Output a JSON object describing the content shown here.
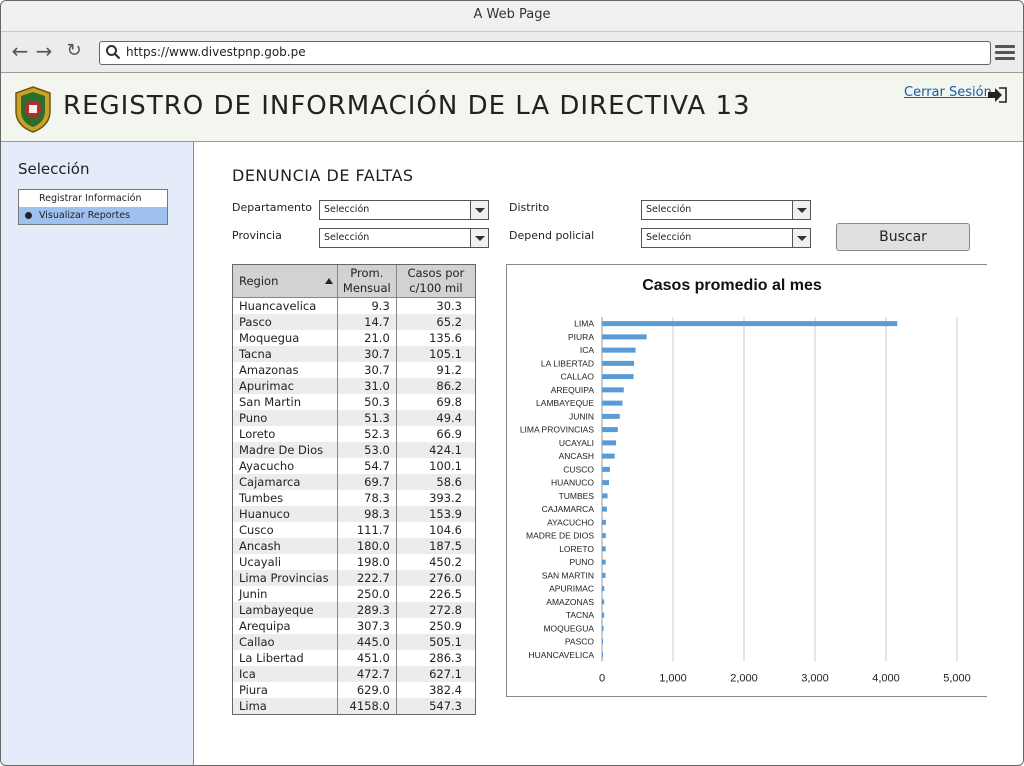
{
  "window": {
    "title": "A Web Page"
  },
  "browser": {
    "url": "https://www.divestpnp.gob.pe"
  },
  "header": {
    "title": "REGISTRO DE INFORMACIÓN DE LA DIRECTIVA 13",
    "logout_label": "Cerrar Sesión"
  },
  "sidebar": {
    "title": "Selección",
    "items": [
      {
        "label": "Registrar Información",
        "active": false
      },
      {
        "label": "Visualizar Reportes",
        "active": true
      }
    ]
  },
  "main": {
    "section_title": "DENUNCIA DE FALTAS",
    "filters": {
      "departamento": {
        "label": "Departamento",
        "value": "Selección"
      },
      "provincia": {
        "label": "Provincia",
        "value": "Selección"
      },
      "distrito": {
        "label": "Distrito",
        "value": "Selección"
      },
      "depend": {
        "label": "Depend policial",
        "value": "Selección"
      }
    },
    "search_label": "Buscar",
    "table": {
      "headers": {
        "region": "Region",
        "prom_1": "Prom.",
        "prom_2": "Mensual",
        "casos_1": "Casos por",
        "casos_2": "c/100 mil"
      },
      "rows": [
        [
          "Huancavelica",
          "9.3",
          "30.3"
        ],
        [
          "Pasco",
          "14.7",
          "65.2"
        ],
        [
          "Moquegua",
          "21.0",
          "135.6"
        ],
        [
          "Tacna",
          "30.7",
          "105.1"
        ],
        [
          "Amazonas",
          "30.7",
          "91.2"
        ],
        [
          "Apurimac",
          "31.0",
          "86.2"
        ],
        [
          "San Martin",
          "50.3",
          "69.8"
        ],
        [
          "Puno",
          "51.3",
          "49.4"
        ],
        [
          "Loreto",
          "52.3",
          "66.9"
        ],
        [
          "Madre De Dios",
          "53.0",
          "424.1"
        ],
        [
          "Ayacucho",
          "54.7",
          "100.1"
        ],
        [
          "Cajamarca",
          "69.7",
          "58.6"
        ],
        [
          "Tumbes",
          "78.3",
          "393.2"
        ],
        [
          "Huanuco",
          "98.3",
          "153.9"
        ],
        [
          "Cusco",
          "111.7",
          "104.6"
        ],
        [
          "Ancash",
          "180.0",
          "187.5"
        ],
        [
          "Ucayali",
          "198.0",
          "450.2"
        ],
        [
          "Lima Provincias",
          "222.7",
          "276.0"
        ],
        [
          "Junin",
          "250.0",
          "226.5"
        ],
        [
          "Lambayeque",
          "289.3",
          "272.8"
        ],
        [
          "Arequipa",
          "307.3",
          "250.9"
        ],
        [
          "Callao",
          "445.0",
          "505.1"
        ],
        [
          "La Libertad",
          "451.0",
          "286.3"
        ],
        [
          "Ica",
          "472.7",
          "627.1"
        ],
        [
          "Piura",
          "629.0",
          "382.4"
        ],
        [
          "Lima",
          "4158.0",
          "547.3"
        ]
      ]
    }
  },
  "chart_data": {
    "type": "bar",
    "orientation": "horizontal",
    "title": "Casos promedio al mes",
    "categories": [
      "LIMA",
      "PIURA",
      "ICA",
      "LA LIBERTAD",
      "CALLAO",
      "AREQUIPA",
      "LAMBAYEQUE",
      "JUNIN",
      "LIMA PROVINCIAS",
      "UCAYALI",
      "ANCASH",
      "CUSCO",
      "HUANUCO",
      "TUMBES",
      "CAJAMARCA",
      "AYACUCHO",
      "MADRE DE DIOS",
      "LORETO",
      "PUNO",
      "SAN MARTIN",
      "APURIMAC",
      "AMAZONAS",
      "TACNA",
      "MOQUEGUA",
      "PASCO",
      "HUANCAVELICA"
    ],
    "values": [
      4158.0,
      629.0,
      472.7,
      451.0,
      445.0,
      307.3,
      289.3,
      250.0,
      222.7,
      198.0,
      180.0,
      111.7,
      98.3,
      78.3,
      69.7,
      54.7,
      53.0,
      52.3,
      51.3,
      50.3,
      31.0,
      30.7,
      30.7,
      21.0,
      14.7,
      9.3
    ],
    "xticks": [
      "0",
      "1,000",
      "2,000",
      "3,000",
      "4,000",
      "5,000"
    ],
    "xlim": [
      0,
      5000
    ],
    "bar_color": "#5b9bd5",
    "grid": true
  }
}
